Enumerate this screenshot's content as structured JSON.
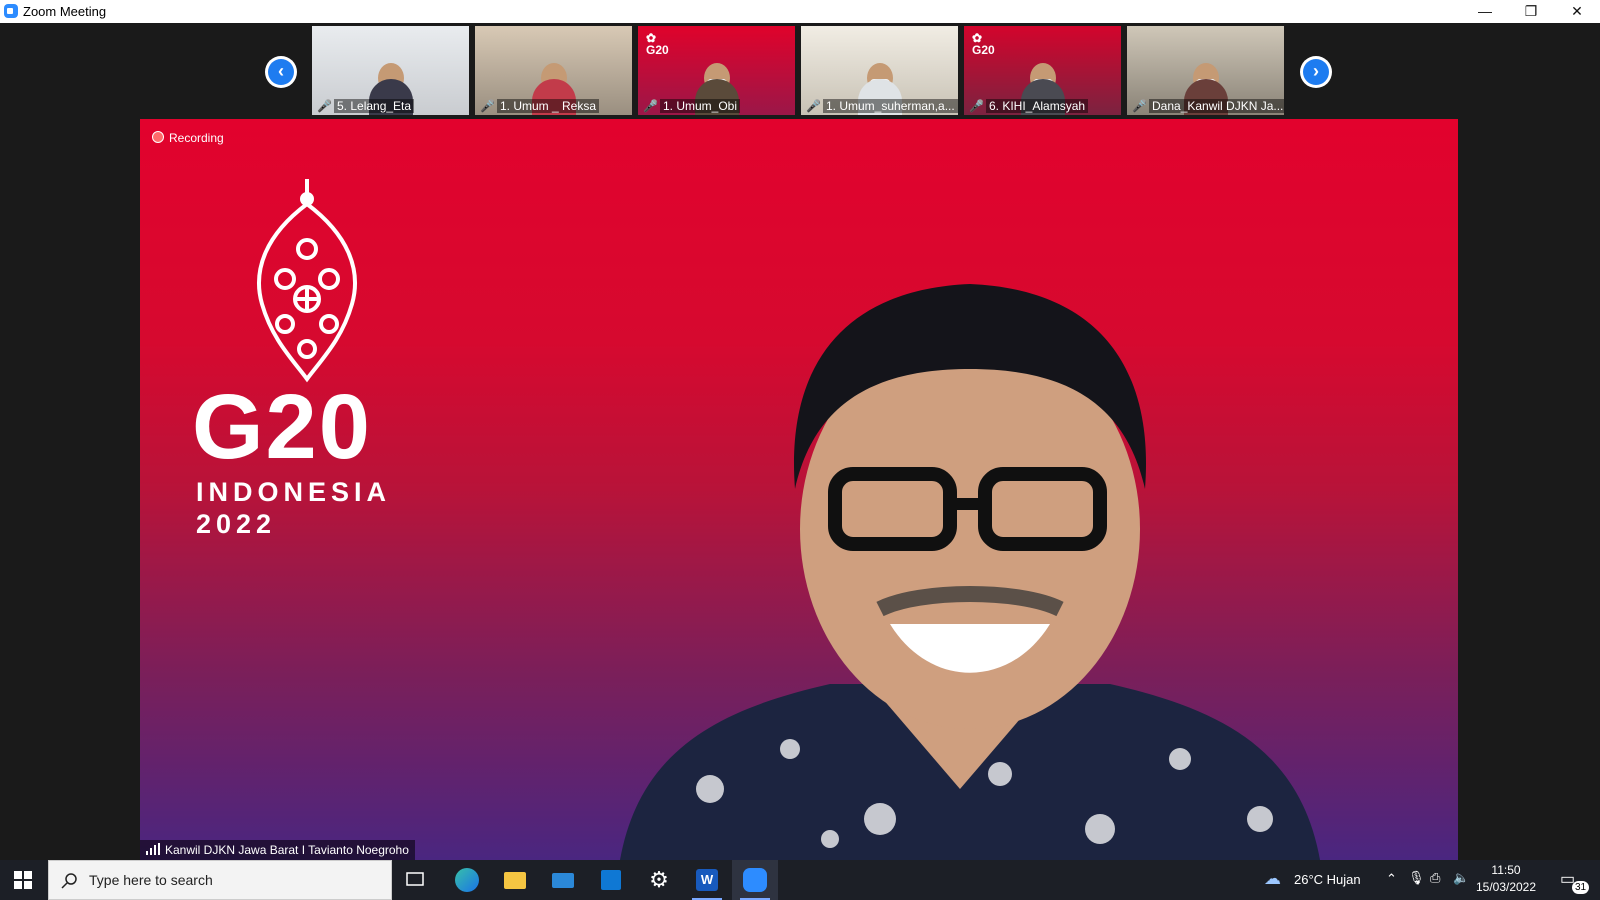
{
  "window": {
    "title": "Zoom Meeting",
    "min": "—",
    "restore": "❐",
    "close": "✕"
  },
  "strip": {
    "prev": "‹",
    "next": "›",
    "participants": [
      {
        "name": "5. Lelang_Eta"
      },
      {
        "name": "1. Umum _ Reksa"
      },
      {
        "name": "1. Umum_Obi"
      },
      {
        "name": "1. Umum_suherman,a..."
      },
      {
        "name": "6. KIHI_Alamsyah"
      },
      {
        "name": "Dana_Kanwil DJKN Ja..."
      }
    ]
  },
  "main": {
    "recording": "Recording",
    "logo": {
      "brand": "G20",
      "country": "INDONESIA",
      "year": "2022"
    },
    "speaker": "Kanwil DJKN Jawa Barat I Tavianto Noegroho"
  },
  "taskbar": {
    "search_placeholder": "Type here to search",
    "weather": "26°C  Hujan",
    "time": "11:50",
    "date": "15/03/2022",
    "notifications": "31"
  },
  "colors": {
    "accent": "#2d8cff",
    "stage_top": "#e2022d",
    "stage_bottom": "#4a2680",
    "muted": "#e2393e"
  }
}
